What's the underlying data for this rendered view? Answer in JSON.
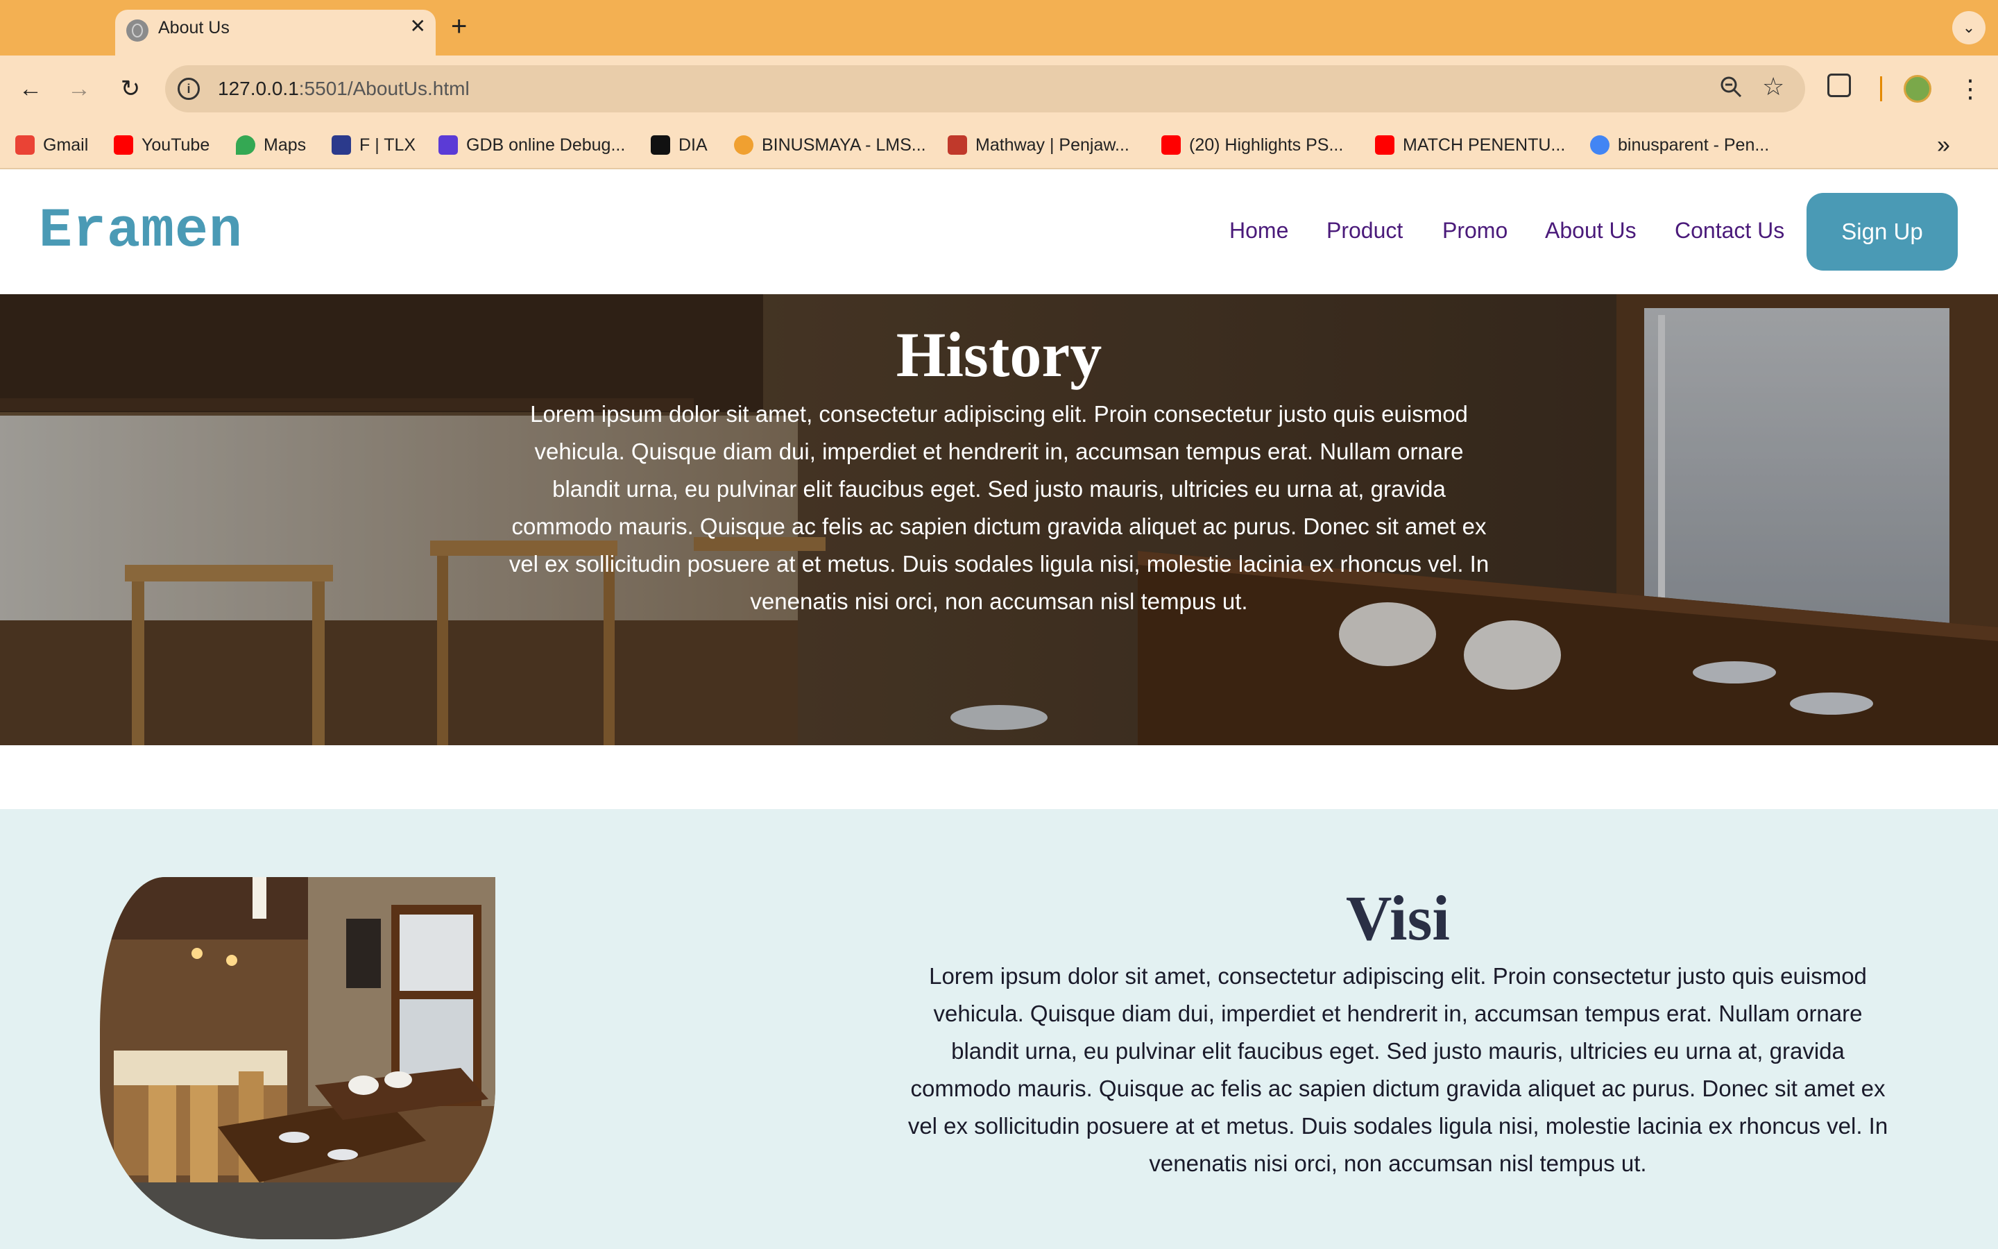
{
  "browser": {
    "tab": {
      "title": "About Us",
      "close": "✕"
    },
    "new_tab": "+",
    "tab_menu": "⌄",
    "back": "←",
    "forward": "→",
    "reload": "↻",
    "url": {
      "host": "127.0.0.1",
      "rest": ":5501/AboutUs.html"
    },
    "bookmarks": [
      {
        "label": "Gmail",
        "icon": "gmail-icon",
        "color": "#ea4335"
      },
      {
        "label": "YouTube",
        "icon": "youtube-icon",
        "color": "#ff0000"
      },
      {
        "label": "Maps",
        "icon": "maps-icon",
        "color": "#34a853"
      },
      {
        "label": "F | TLX",
        "icon": "tlx-icon",
        "color": "#2b3a8c"
      },
      {
        "label": "GDB online Debug...",
        "icon": "gdb-icon",
        "color": "#5b3bd6"
      },
      {
        "label": "DIA",
        "icon": "dia-icon",
        "color": "#111111"
      },
      {
        "label": "BINUSMAYA - LMS...",
        "icon": "binusmaya-icon",
        "color": "#f0a030"
      },
      {
        "label": "Mathway | Penjaw...",
        "icon": "mathway-icon",
        "color": "#c0392b"
      },
      {
        "label": "(20) Highlights PS...",
        "icon": "youtube-icon",
        "color": "#ff0000"
      },
      {
        "label": "MATCH PENENTU...",
        "icon": "youtube-icon",
        "color": "#ff0000"
      },
      {
        "label": "binusparent - Pen...",
        "icon": "google-icon",
        "color": "#4285f4"
      }
    ],
    "bookmarks_more": "»"
  },
  "site": {
    "logo": "Eramen",
    "nav": [
      "Home",
      "Product",
      "Promo",
      "About Us",
      "Contact Us"
    ],
    "signup": "Sign Up"
  },
  "history": {
    "title": "History",
    "text": "Lorem ipsum dolor sit amet, consectetur adipiscing elit. Proin consectetur justo quis euismod vehicula. Quisque diam dui, imperdiet et hendrerit in, accumsan tempus erat. Nullam ornare blandit urna, eu pulvinar elit faucibus eget. Sed justo mauris, ultricies eu urna at, gravida commodo mauris. Quisque ac felis ac sapien dictum gravida aliquet ac purus. Donec sit amet ex vel ex sollicitudin posuere at et metus. Duis sodales ligula nisi, molestie lacinia ex rhoncus vel. In venenatis nisi orci, non accumsan nisl tempus ut."
  },
  "visi": {
    "title": "Visi",
    "text": "Lorem ipsum dolor sit amet, consectetur adipiscing elit. Proin consectetur justo quis euismod vehicula. Quisque diam dui, imperdiet et hendrerit in, accumsan tempus erat. Nullam ornare blandit urna, eu pulvinar elit faucibus eget. Sed justo mauris, ultricies eu urna at, gravida commodo mauris. Quisque ac felis ac sapien dictum gravida aliquet ac purus. Donec sit amet ex vel ex sollicitudin posuere at et metus. Duis sodales ligula nisi, molestie lacinia ex rhoncus vel. In venenatis nisi orci, non accumsan nisl tempus ut."
  },
  "colors": {
    "tabstrip": "#f3b052",
    "toolbar": "#fbe0c0",
    "brand": "#4a9ab5",
    "nav_link": "#4a1a7a",
    "visi_bg": "#e3f1f2",
    "visi_title": "#2a2f45"
  }
}
